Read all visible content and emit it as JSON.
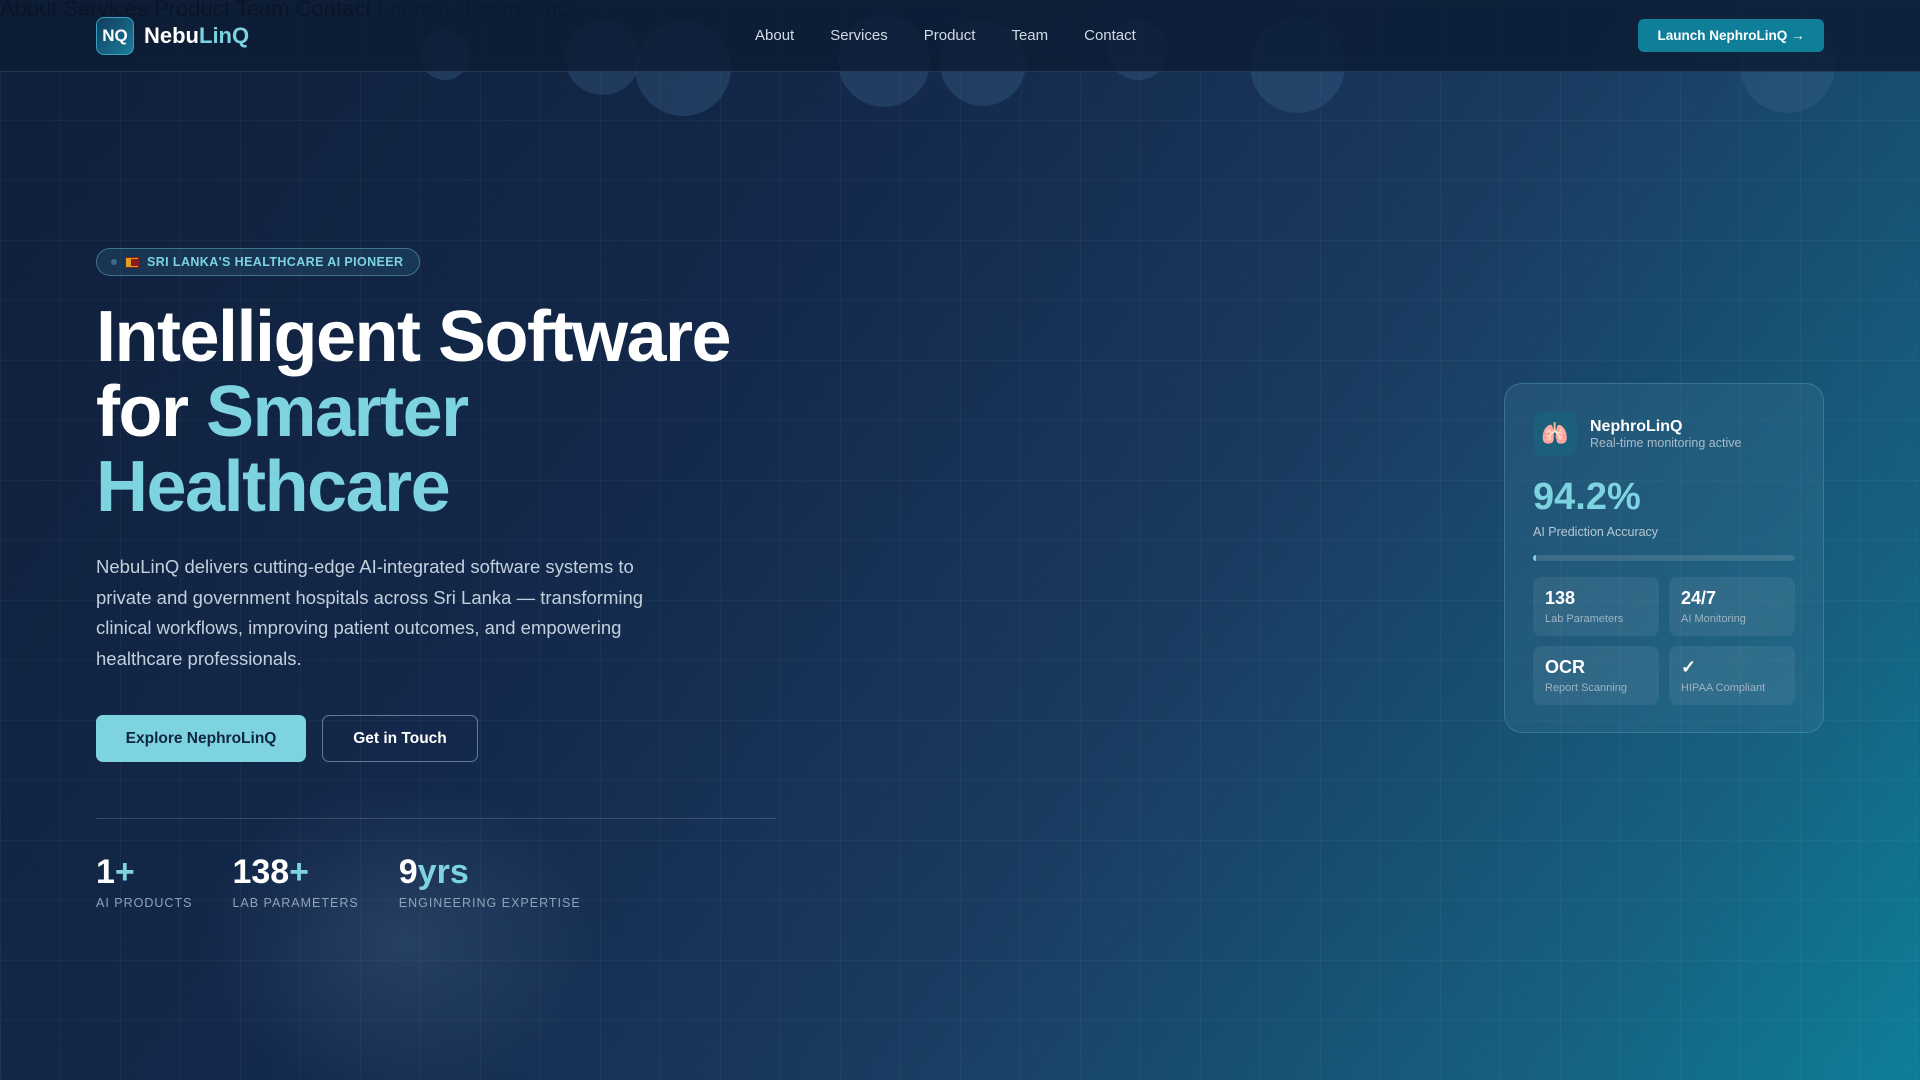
{
  "nav": {
    "logo_mark": "NQ",
    "brand_part1": "Nebu",
    "brand_part2": "LinQ",
    "links": [
      "About",
      "Services",
      "Product",
      "Team",
      "Contact"
    ],
    "cta": "Launch NephroLinQ →"
  },
  "hero": {
    "badge": "SRI LANKA'S HEALTHCARE AI PIONEER",
    "title_line1": "Intelligent Software",
    "title_for": "for ",
    "title_accent1": "Smarter",
    "title_accent2": "Healthcare",
    "description": "NebuLinQ delivers cutting-edge AI-integrated software systems to private and government hospitals across Sri Lanka — transforming clinical workflows, improving patient outcomes, and empowering healthcare professionals.",
    "primary_button": "Explore NephroLinQ",
    "secondary_button": "Get in Touch",
    "stats": [
      {
        "value": "1",
        "suffix": "+",
        "label": "AI PRODUCTS"
      },
      {
        "value": "138",
        "suffix": "+",
        "label": "LAB PARAMETERS"
      },
      {
        "value": "9",
        "suffix": "yrs",
        "label": "ENGINEERING EXPERTISE"
      }
    ]
  },
  "card": {
    "icon": "🫁",
    "title": "NephroLinQ",
    "subtitle": "Real-time monitoring active",
    "metric": "94.2%",
    "metric_label": "AI Prediction Accuracy",
    "progress_percent": 1,
    "tiles": [
      {
        "value": "138",
        "label": "Lab Parameters"
      },
      {
        "value": "24/7",
        "label": "AI Monitoring"
      },
      {
        "value": "OCR",
        "label": "Report Scanning"
      },
      {
        "value": "✓",
        "label": "HIPAA Compliant"
      }
    ]
  },
  "colors": {
    "accent": "#7dd3e0",
    "button": "#0f7f99"
  }
}
